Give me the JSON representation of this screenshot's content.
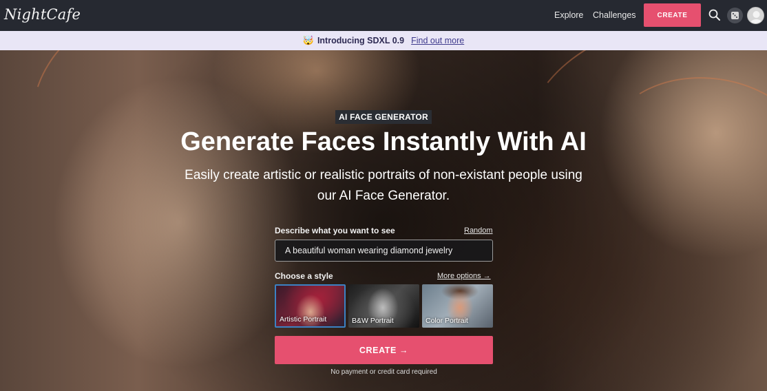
{
  "nav": {
    "logo": "NightCafe",
    "explore": "Explore",
    "challenges": "Challenges",
    "create": "CREATE",
    "icons": {
      "search": "search-icon",
      "dice": "dice-icon",
      "avatar": "avatar"
    }
  },
  "announcement": {
    "emoji": "🤯",
    "title": "Introducing SDXL 0.9",
    "link": "Find out more"
  },
  "hero": {
    "badge": "AI FACE GENERATOR",
    "headline": "Generate Faces Instantly With AI",
    "subhead": "Easily create artistic or realistic portraits of non-existant people using our AI Face Generator."
  },
  "form": {
    "prompt_label": "Describe what you want to see",
    "random_link": "Random",
    "prompt_value": "A beautiful woman wearing diamond jewelry",
    "style_label": "Choose a style",
    "more_options": "More options →",
    "styles": [
      {
        "label": "Artistic Portrait",
        "selected": true
      },
      {
        "label": "B&W Portrait",
        "selected": false
      },
      {
        "label": "Color Portrait",
        "selected": false
      }
    ],
    "create_button": "CREATE →",
    "note": "No payment or credit card required"
  },
  "colors": {
    "accent": "#e6506f",
    "navbar": "#262931",
    "announce_bg": "#e9e6f6",
    "selected_border": "#3b82c4"
  }
}
